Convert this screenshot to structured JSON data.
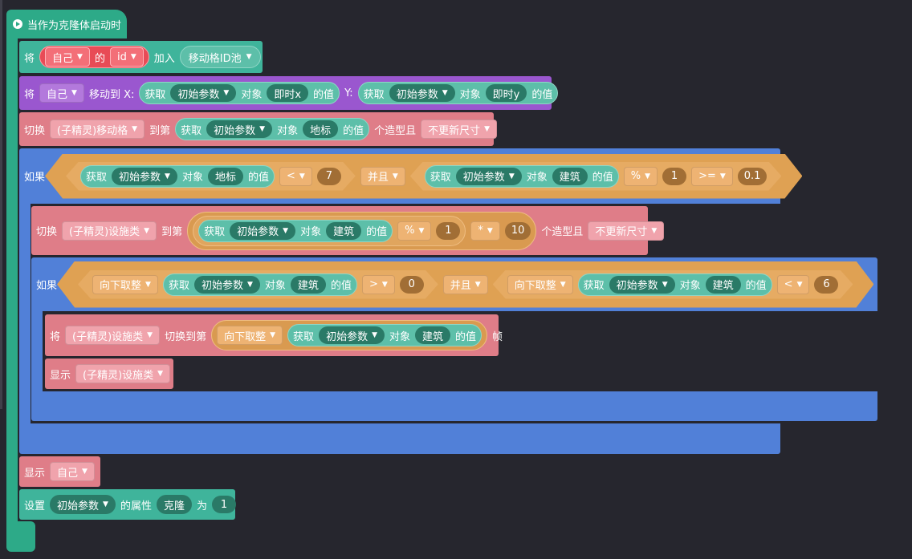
{
  "event": {
    "label": "当作为克隆体启动时"
  },
  "blocks": {
    "add": {
      "will": "将",
      "self": "自己",
      "of": "的",
      "id": "id",
      "join": "加入",
      "list": "移动格ID池"
    },
    "move": {
      "will": "将",
      "self": "自己",
      "moveto": "移动到 X:",
      "get": "获取",
      "params": "初始参数",
      "obj": "对象",
      "xkey": "即时x",
      "val": "的值",
      "ylabel": "Y:",
      "ykey": "即时y"
    },
    "switch1": {
      "label": "切换",
      "sprite": "(子精灵)移动格",
      "to": "到第",
      "get": "获取",
      "params": "初始参数",
      "obj": "对象",
      "key": "地标",
      "val": "的值",
      "suffix": "个造型且",
      "resize": "不更新尺寸"
    },
    "if1": {
      "label": "如果",
      "get": "获取",
      "params": "初始参数",
      "obj": "对象",
      "key1": "地标",
      "val": "的值",
      "op1": "<",
      "n1": "7",
      "and": "并且",
      "key2": "建筑",
      "op2": "%",
      "n2": "1",
      "op3": ">=",
      "n3": "0.1"
    },
    "switch2": {
      "label": "切换",
      "sprite": "(子精灵)设施类",
      "to": "到第",
      "get": "获取",
      "params": "初始参数",
      "obj": "对象",
      "key": "建筑",
      "val": "的值",
      "op1": "%",
      "n1": "1",
      "op2": "*",
      "n2": "10",
      "suffix": "个造型且",
      "resize": "不更新尺寸"
    },
    "if2": {
      "label": "如果",
      "floor": "向下取整",
      "get": "获取",
      "params": "初始参数",
      "obj": "对象",
      "key": "建筑",
      "val": "的值",
      "op1": ">",
      "n1": "0",
      "and": "并且",
      "op2": "<",
      "n2": "6"
    },
    "frame": {
      "will": "将",
      "sprite": "(子精灵)设施类",
      "switchto": "切换到第",
      "floor": "向下取整",
      "get": "获取",
      "params": "初始参数",
      "obj": "对象",
      "key": "建筑",
      "val": "的值",
      "suffix": "帧"
    },
    "show1": {
      "label": "显示",
      "sprite": "(子精灵)设施类"
    },
    "show2": {
      "label": "显示",
      "self": "自己"
    },
    "set": {
      "label": "设置",
      "params": "初始参数",
      "prop": "的属性",
      "key": "克隆",
      "as": "为",
      "value": "1"
    }
  },
  "icons": {
    "event": "play-circle-icon",
    "dropdown": "triangle-down-icon"
  },
  "colors": {
    "background": "#26262e",
    "event": "#2daa88",
    "data": "#3fb49b",
    "motion": "#9a57cf",
    "looks": "#df7d88",
    "control": "#5180d8",
    "operator": "#dfa153"
  }
}
